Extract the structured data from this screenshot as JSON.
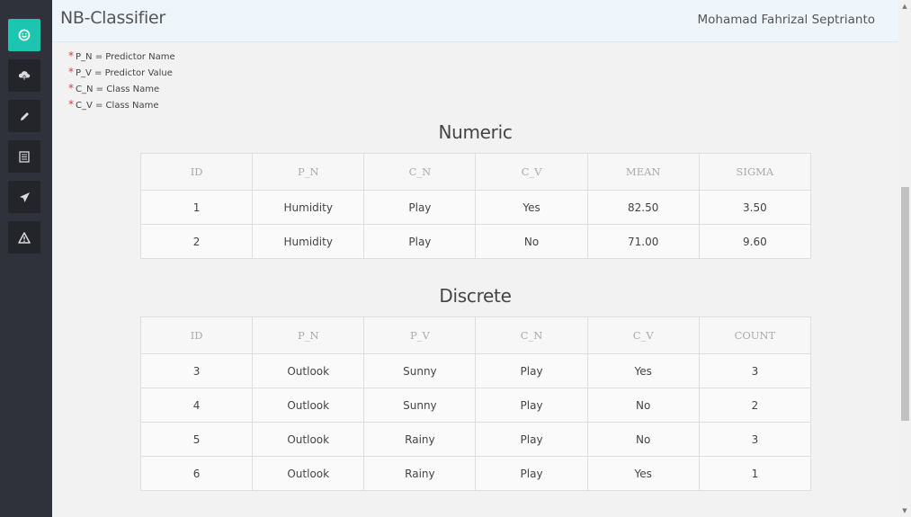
{
  "app": {
    "title": "NB-Classifier",
    "user": "Mohamad Fahrizal Septrianto"
  },
  "sidebar": {
    "items": [
      {
        "icon": "smile-icon",
        "active": true
      },
      {
        "icon": "cloud-upload-icon",
        "active": false
      },
      {
        "icon": "pencil-icon",
        "active": false
      },
      {
        "icon": "table-icon",
        "active": false
      },
      {
        "icon": "send-icon",
        "active": false
      },
      {
        "icon": "warning-icon",
        "active": false
      }
    ]
  },
  "legend": [
    {
      "star": "*",
      "text": "P_N = Predictor Name"
    },
    {
      "star": "*",
      "text": "P_V = Predictor Value"
    },
    {
      "star": "*",
      "text": "C_N = Class Name"
    },
    {
      "star": "*",
      "text": "C_V = Class Name"
    }
  ],
  "numeric": {
    "title": "Numeric",
    "headers": [
      "ID",
      "P_N",
      "C_N",
      "C_V",
      "MEAN",
      "SIGMA"
    ],
    "rows": [
      [
        "1",
        "Humidity",
        "Play",
        "Yes",
        "82.50",
        "3.50"
      ],
      [
        "2",
        "Humidity",
        "Play",
        "No",
        "71.00",
        "9.60"
      ]
    ]
  },
  "discrete": {
    "title": "Discrete",
    "headers": [
      "ID",
      "P_N",
      "P_V",
      "C_N",
      "C_V",
      "COUNT"
    ],
    "rows": [
      [
        "3",
        "Outlook",
        "Sunny",
        "Play",
        "Yes",
        "3"
      ],
      [
        "4",
        "Outlook",
        "Sunny",
        "Play",
        "No",
        "2"
      ],
      [
        "5",
        "Outlook",
        "Rainy",
        "Play",
        "No",
        "3"
      ],
      [
        "6",
        "Outlook",
        "Rainy",
        "Play",
        "Yes",
        "1"
      ]
    ]
  },
  "colors": {
    "accent": "#1dc4b0",
    "sidebar": "#2f323a",
    "header": "#eef5fb",
    "required_star": "#e03b3b"
  }
}
